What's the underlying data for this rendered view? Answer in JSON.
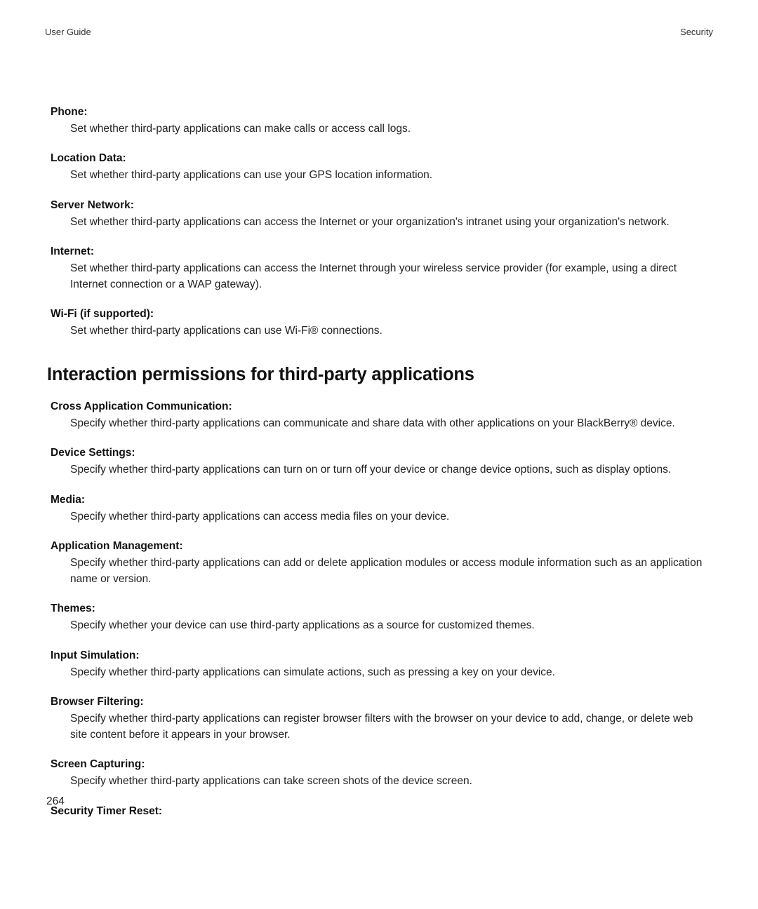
{
  "header": {
    "left": "User Guide",
    "right": "Security"
  },
  "topItems": [
    {
      "title": "Phone:",
      "desc": "Set whether third-party applications can make calls or access call logs."
    },
    {
      "title": "Location Data:",
      "desc": "Set whether third-party applications can use your GPS location information."
    },
    {
      "title": "Server Network:",
      "desc": "Set whether third-party applications can access the Internet or your organization's intranet using your organization's network."
    },
    {
      "title": "Internet:",
      "desc": "Set whether third-party applications can access the Internet through your wireless service provider (for example, using a direct Internet connection or a WAP gateway)."
    },
    {
      "title": "Wi-Fi (if supported):",
      "desc": "Set whether third-party applications can use Wi-Fi® connections."
    }
  ],
  "sectionHeading": "Interaction permissions for third-party applications",
  "bottomItems": [
    {
      "title": "Cross Application Communication:",
      "desc": "Specify whether third-party applications can communicate and share data with other applications on your BlackBerry® device."
    },
    {
      "title": "Device Settings:",
      "desc": "Specify whether third-party applications can turn on or turn off your device or change device options, such as display options."
    },
    {
      "title": "Media:",
      "desc": "Specify whether third-party applications can access media files on your device."
    },
    {
      "title": "Application Management:",
      "desc": "Specify whether third-party applications can add or delete application modules or access module information such as an application name or version."
    },
    {
      "title": "Themes:",
      "desc": "Specify whether your device can use third-party applications as a source for customized themes."
    },
    {
      "title": "Input Simulation:",
      "desc": "Specify whether third-party applications can simulate actions, such as pressing a key on your device."
    },
    {
      "title": "Browser Filtering:",
      "desc": "Specify whether third-party applications can register browser filters with the browser on your device to add, change, or delete web site content before it appears in your browser."
    },
    {
      "title": "Screen Capturing:",
      "desc": "Specify whether third-party applications can take screen shots of the device screen."
    },
    {
      "title": "Security Timer Reset:",
      "desc": ""
    }
  ],
  "pageNumber": "264"
}
